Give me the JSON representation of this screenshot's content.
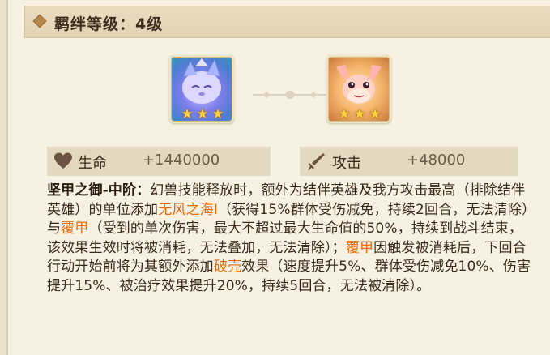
{
  "header": {
    "title": "羁绊等级：4级"
  },
  "heroes": [
    {
      "name": "blue-spirit-beast",
      "stars": 3,
      "color": "#7d7dea"
    },
    {
      "name": "pink-dolphin-beast",
      "stars": 3,
      "color": "#f7b86f"
    }
  ],
  "stats": {
    "hp": {
      "label": "生命",
      "value": "+1440000",
      "icon": "heart-icon"
    },
    "atk": {
      "label": "攻击",
      "value": "+48000",
      "icon": "sword-icon"
    }
  },
  "description": {
    "skill_name": "坚甲之御-中阶：",
    "segments": [
      {
        "t": "幻兽技能释放时，额外为结伴英雄及我方攻击最高（排除结伴英雄）的单位添加"
      },
      {
        "t": "无风之海Ⅰ",
        "hl": true
      },
      {
        "t": "（获得15%群体受伤减免，持续2回合，无法清除）与"
      },
      {
        "t": "覆甲",
        "hl": true
      },
      {
        "t": "（受到的单次伤害，最大不超过最大生命值的50%，持续到战斗结束，该效果生效时将被消耗，无法叠加，无法清除）；"
      },
      {
        "t": "覆甲",
        "hl": true
      },
      {
        "t": "因触发被消耗后，下回合行动开始前将为其额外添加"
      },
      {
        "t": "破壳",
        "hl": true
      },
      {
        "t": "效果（速度提升5%、群体受伤减免10%、伤害提升15%、被治疗效果提升20%，持续5回合，无法被清除）。"
      }
    ]
  },
  "colors": {
    "highlight": "#e86a0e",
    "panel": "#f6f1e2",
    "stat_bg": "#e3d9c1",
    "star": "#ffd23f"
  }
}
